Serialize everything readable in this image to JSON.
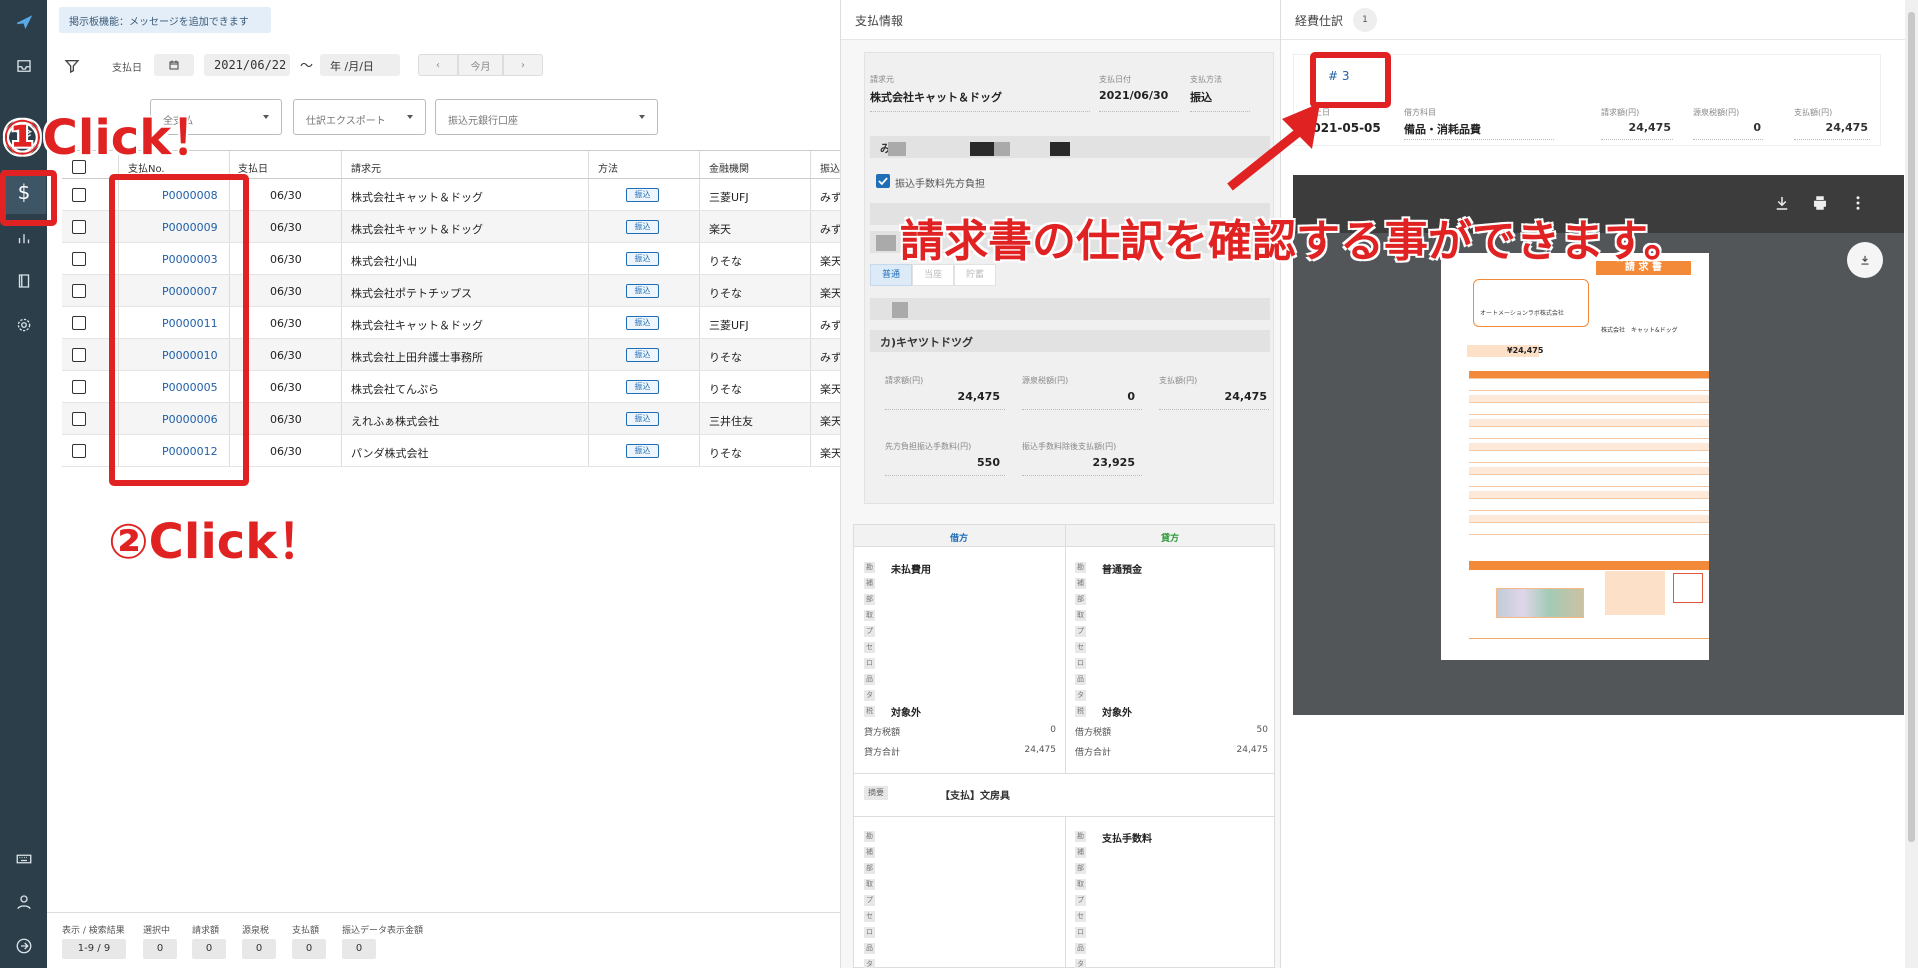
{
  "message_box": "掲示板機能：メッセージを追加できます",
  "filter": {
    "label": "支払日",
    "date_from": "2021/06/22",
    "tilde": "～",
    "date_to": "年 /月/日",
    "prev": "‹",
    "today": "今月",
    "next": "›"
  },
  "selects": [
    {
      "label": "全支払"
    },
    {
      "label": "仕訳エクスポート"
    },
    {
      "label": "振込元銀行口座"
    }
  ],
  "table": {
    "headers": [
      "支払No.",
      "支払日",
      "請求元",
      "方法",
      "金融機関",
      "振込"
    ],
    "rows": [
      {
        "no": "P0000008",
        "date": "06/30",
        "vendor": "株式会社キャット＆ドッグ",
        "method": "振込",
        "bank": "三菱UFJ",
        "dest": "みず"
      },
      {
        "no": "P0000009",
        "date": "06/30",
        "vendor": "株式会社キャット＆ドッグ",
        "method": "振込",
        "bank": "楽天",
        "dest": "みず"
      },
      {
        "no": "P0000003",
        "date": "06/30",
        "vendor": "株式会社小山",
        "method": "振込",
        "bank": "りそな",
        "dest": "楽天"
      },
      {
        "no": "P0000007",
        "date": "06/30",
        "vendor": "株式会社ポテトチップス",
        "method": "振込",
        "bank": "りそな",
        "dest": "楽天"
      },
      {
        "no": "P0000011",
        "date": "06/30",
        "vendor": "株式会社キャット＆ドッグ",
        "method": "振込",
        "bank": "三菱UFJ",
        "dest": "みず"
      },
      {
        "no": "P0000010",
        "date": "06/30",
        "vendor": "株式会社上田弁護士事務所",
        "method": "振込",
        "bank": "りそな",
        "dest": "みず"
      },
      {
        "no": "P0000005",
        "date": "06/30",
        "vendor": "株式会社てんぷら",
        "method": "振込",
        "bank": "りそな",
        "dest": "楽天"
      },
      {
        "no": "P0000006",
        "date": "06/30",
        "vendor": "えれふぁ株式会社",
        "method": "振込",
        "bank": "三井住友",
        "dest": "楽天"
      },
      {
        "no": "P0000012",
        "date": "06/30",
        "vendor": "パンダ株式会社",
        "method": "振込",
        "bank": "りそな",
        "dest": "楽天"
      }
    ]
  },
  "footer": {
    "labels": [
      "表示 / 検索結果",
      "選択中",
      "請求額",
      "源泉税",
      "支払額",
      "振込データ表示金額"
    ],
    "values": [
      "1-9 / 9",
      "0",
      "0",
      "0",
      "0",
      "0"
    ]
  },
  "payment": {
    "title": "支払情報",
    "vendor_label": "請求元",
    "vendor": "株式会社キャット＆ドッグ",
    "date_label": "支払日付",
    "date": "2021/06/30",
    "method_label": "支払方法",
    "method": "振込",
    "bank_partial": "み",
    "fee_checkbox": "振込手数料先方負担",
    "account_types": [
      "普通",
      "当座",
      "貯蓄"
    ],
    "account_name": "カ)キヤツトドツグ",
    "invoice_label": "請求額(円)",
    "invoice": "24,475",
    "withholding_label": "源泉税額(円)",
    "withholding": "0",
    "pay_label": "支払額(円)",
    "pay": "24,475",
    "fee_label": "先方負担振込手数料(円)",
    "fee": "550",
    "net_label": "振込手数料除後支払額(円)",
    "net": "23,925"
  },
  "journal": {
    "debit": "借方",
    "credit": "貸方",
    "keys": [
      "勘",
      "補",
      "部",
      "取",
      "プ",
      "セ",
      "ロ",
      "品",
      "タ",
      "税"
    ],
    "debit_account": "未払費用",
    "credit_account": "普通預金",
    "tax_debit": "対象外",
    "tax_credit": "対象外",
    "debit_tax_label": "貸方税額",
    "debit_tax": "0",
    "debit_total_label": "貸方合計",
    "debit_total": "24,475",
    "credit_tax_label": "借方税額",
    "credit_tax": "50",
    "credit_total_label": "借方合計",
    "credit_total": "24,475",
    "summary_label": "摘要",
    "summary": "【支払】文房具",
    "second_credit": "支払手数料"
  },
  "expense": {
    "title": "経費仕訳",
    "count": "1",
    "entry_no": "# 3",
    "date_label": "計上日",
    "date": "2021-05-05",
    "account_label": "借方科目",
    "account": "備品・消耗品費",
    "invoice_label": "請求額(円)",
    "invoice": "24,475",
    "tax_label": "源泉税額(円)",
    "tax": "0",
    "pay_label": "支払額(円)",
    "pay": "24,475"
  },
  "pdf": {
    "page_title": "請 求 書",
    "total": "¥24,475",
    "company": "株式会社　キャット&ドッグ",
    "to": "オートメーションラボ株式会社"
  },
  "annotations": {
    "step1": "①Click！",
    "step2": "②Click！",
    "callout": "請求書の仕訳を確認する事ができます。"
  },
  "colors": {
    "sidebar": "#2c3e4a",
    "link": "#1f5fa8",
    "annotation": "#e12222",
    "invoice_accent": "#f28a3a"
  }
}
